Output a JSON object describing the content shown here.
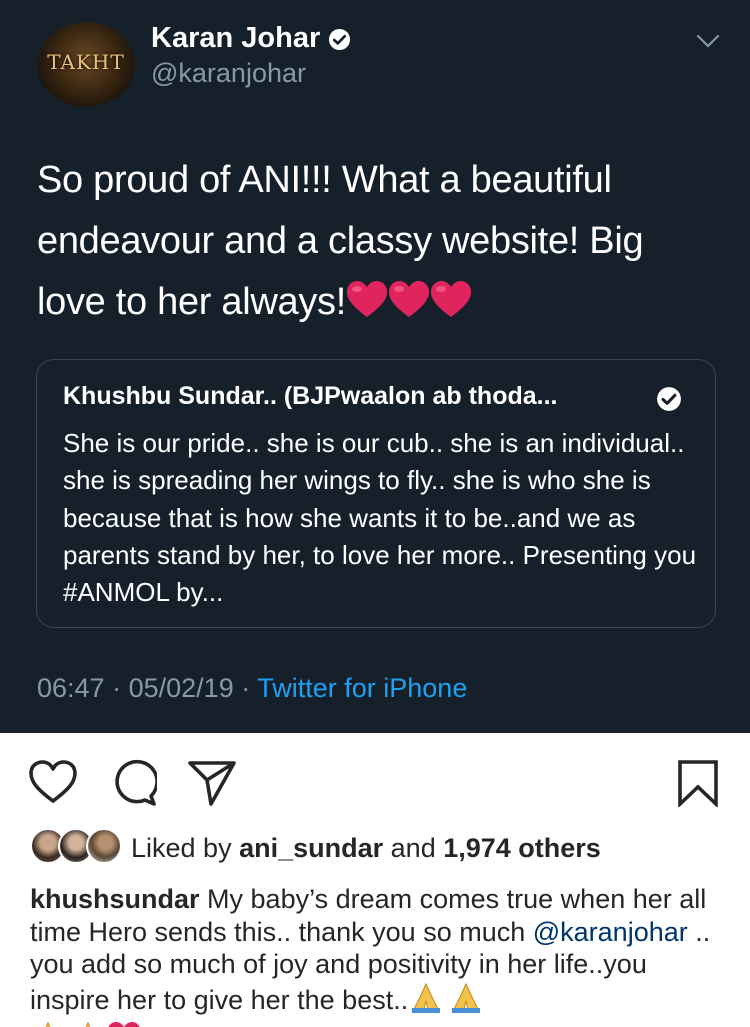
{
  "tweet": {
    "author_name": "Karan Johar",
    "handle": "@karanjohar",
    "avatar_text": "TAKHT",
    "text": "So proud of ANI!!! What a beautiful endeavour and a classy website! Big love to her always!",
    "quote": {
      "author": "Khushbu Sundar.. (BJPwaalon ab thoda...",
      "text": "She is our pride.. she is our cub.. she is an individual.. she is spreading her wings to fly.. she is who she is because that is how she wants it to be..and we as parents stand by her, to love her more.. Presenting you #ANMOL by..."
    },
    "time": "06:47",
    "date": "05/02/19",
    "source": "Twitter for iPhone"
  },
  "post": {
    "liked_by_prefix": "Liked by",
    "liked_by_user": "ani_sundar",
    "and": "and",
    "others_count": "1,974 others",
    "caption_user": "khushsundar",
    "caption_text_1": "My baby’s dream comes true when her all time Hero sends this.. thank you so much",
    "caption_mention": "@karanjohar",
    "caption_text_2": ".. you add so much of joy and positivity in her life..you inspire her to give her the best.."
  },
  "icons": [
    "verified-icon",
    "chevron-down-icon",
    "heart-icon",
    "comment-icon",
    "share-icon",
    "bookmark-icon",
    "folded-hands-emoji",
    "red-heart-emoji"
  ],
  "colors": {
    "tweet_background": "#15202b",
    "tweet_secondary": "#8899a6",
    "twitter_blue": "#1da1f2",
    "heart_red": "#e0245e",
    "mention_blue": "#003569"
  }
}
